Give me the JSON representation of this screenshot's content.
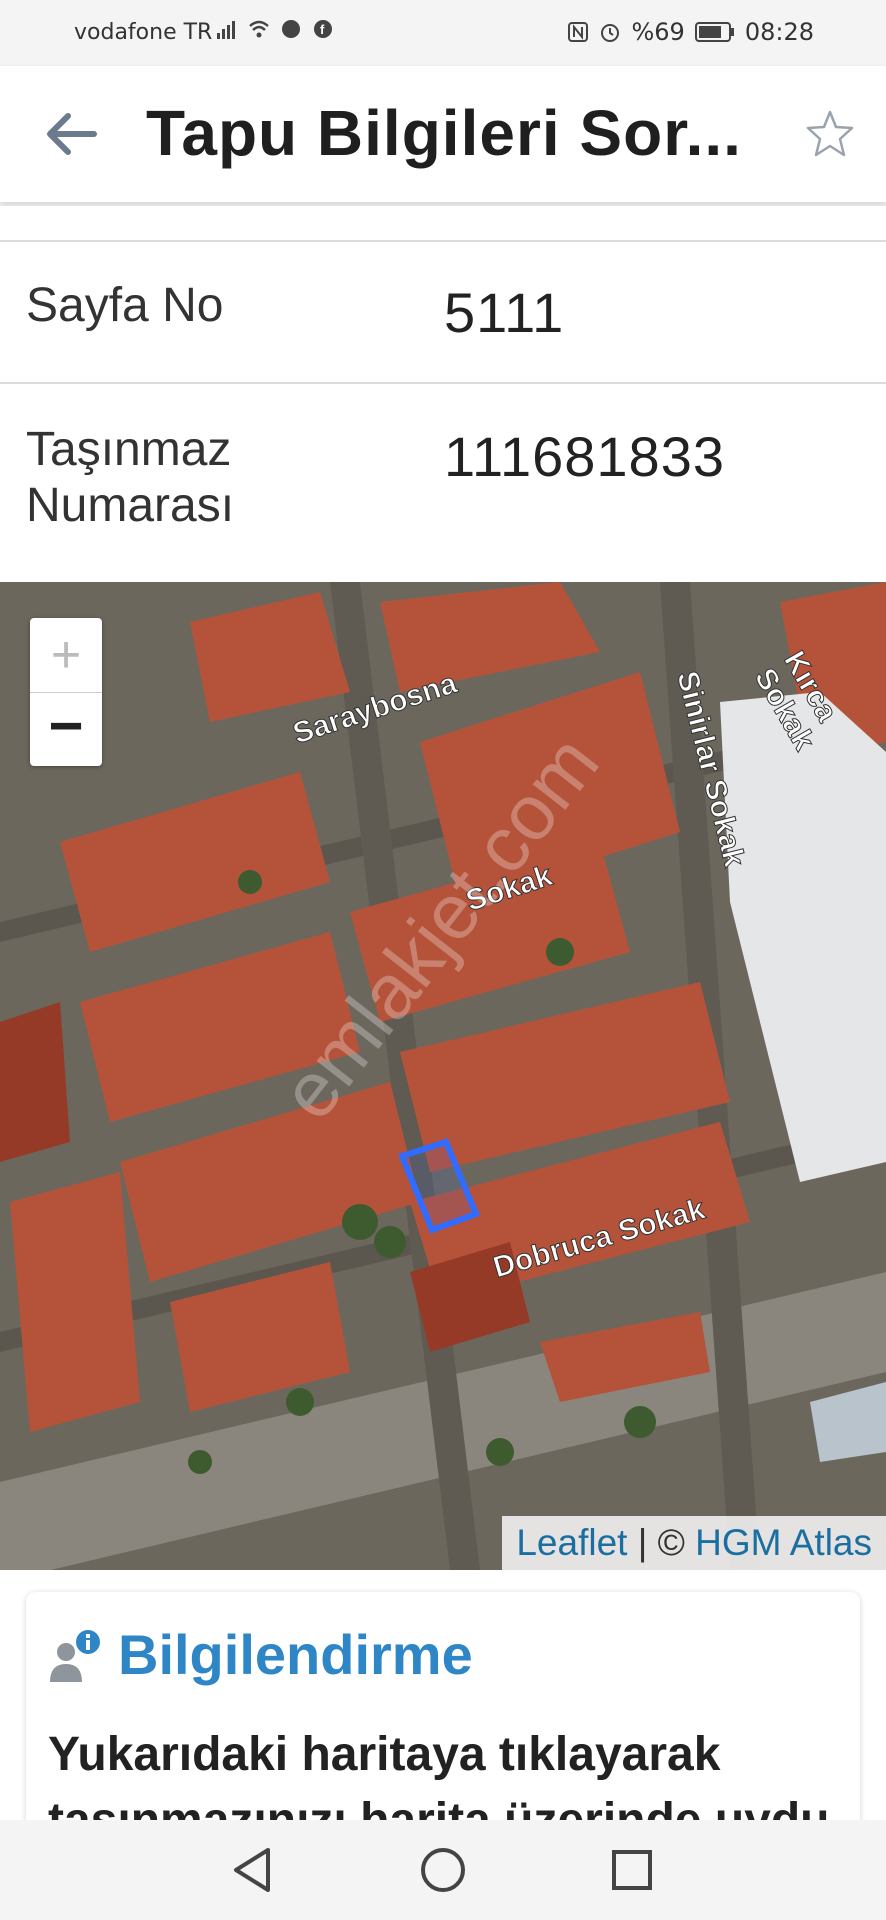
{
  "status_bar": {
    "carrier": "vodafone TR",
    "battery": "%69",
    "time": "08:28"
  },
  "header": {
    "title": "Tapu Bilgileri Sor..."
  },
  "details": [
    {
      "label": "Sayfa No",
      "value": "5111"
    },
    {
      "label": "Taşınmaz Numarası",
      "value": "111681833"
    }
  ],
  "map": {
    "zoom_in_label": "+",
    "zoom_out_label": "−",
    "attribution_leaflet": "Leaflet",
    "attribution_separator": " | © ",
    "attribution_source": "HGM Atlas",
    "street_labels": [
      "Saraybosna",
      "Sokak",
      "Sinirlar Sokak",
      "Kırca Sokak",
      "Dobruca Sokak"
    ],
    "watermark": "emlakjet.com",
    "parcel_color": "#2f6cff"
  },
  "info": {
    "title": "Bilgilendirme",
    "text": "Yukarıdaki haritaya tıklayarak taşınmazınızı harita üzerinde uydu"
  },
  "colors": {
    "accent": "#2f86c7",
    "link": "#1a6fa0"
  }
}
